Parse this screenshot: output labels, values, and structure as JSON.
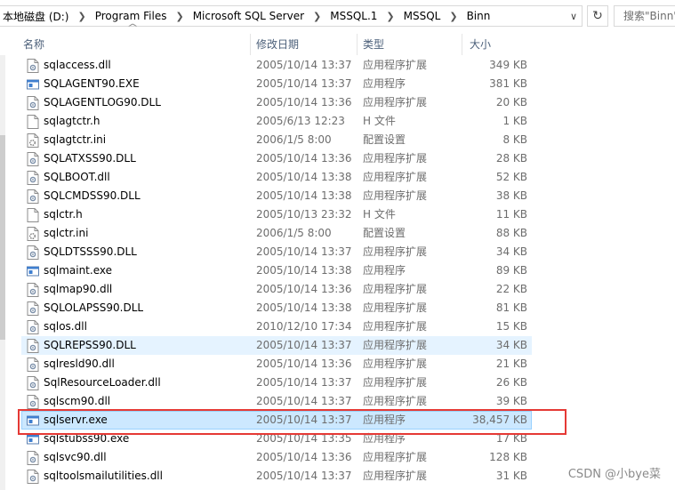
{
  "address": {
    "crumbs": [
      "本地磁盘 (D:)",
      "Program Files",
      "Microsoft SQL Server",
      "MSSQL.1",
      "MSSQL",
      "Binn"
    ]
  },
  "search": {
    "placeholder": "搜索\"Binn\""
  },
  "columns": {
    "name": "名称",
    "date": "修改日期",
    "type": "类型",
    "size": "大小"
  },
  "files": [
    {
      "name": "sqlaccess.dll",
      "date": "2005/10/14 13:37",
      "type": "应用程序扩展",
      "size": "349 KB",
      "icon": "dll-icon"
    },
    {
      "name": "SQLAGENT90.EXE",
      "date": "2005/10/14 13:37",
      "type": "应用程序",
      "size": "381 KB",
      "icon": "exe-icon"
    },
    {
      "name": "SQLAGENTLOG90.DLL",
      "date": "2005/10/14 13:36",
      "type": "应用程序扩展",
      "size": "20 KB",
      "icon": "dll-icon"
    },
    {
      "name": "sqlagtctr.h",
      "date": "2005/6/13 12:23",
      "type": "H 文件",
      "size": "1 KB",
      "icon": "file-icon"
    },
    {
      "name": "sqlagtctr.ini",
      "date": "2006/1/5 8:00",
      "type": "配置设置",
      "size": "8 KB",
      "icon": "ini-icon"
    },
    {
      "name": "SQLATXSS90.DLL",
      "date": "2005/10/14 13:36",
      "type": "应用程序扩展",
      "size": "28 KB",
      "icon": "dll-icon"
    },
    {
      "name": "SQLBOOT.dll",
      "date": "2005/10/14 13:38",
      "type": "应用程序扩展",
      "size": "52 KB",
      "icon": "dll-icon"
    },
    {
      "name": "SQLCMDSS90.DLL",
      "date": "2005/10/14 13:38",
      "type": "应用程序扩展",
      "size": "38 KB",
      "icon": "dll-icon"
    },
    {
      "name": "sqlctr.h",
      "date": "2005/10/13 23:32",
      "type": "H 文件",
      "size": "11 KB",
      "icon": "file-icon"
    },
    {
      "name": "sqlctr.ini",
      "date": "2006/1/5 8:00",
      "type": "配置设置",
      "size": "88 KB",
      "icon": "ini-icon"
    },
    {
      "name": "SQLDTSSS90.DLL",
      "date": "2005/10/14 13:37",
      "type": "应用程序扩展",
      "size": "34 KB",
      "icon": "dll-icon"
    },
    {
      "name": "sqlmaint.exe",
      "date": "2005/10/14 13:38",
      "type": "应用程序",
      "size": "89 KB",
      "icon": "exe-icon"
    },
    {
      "name": "sqlmap90.dll",
      "date": "2005/10/14 13:36",
      "type": "应用程序扩展",
      "size": "22 KB",
      "icon": "dll-icon"
    },
    {
      "name": "SQLOLAPSS90.DLL",
      "date": "2005/10/14 13:38",
      "type": "应用程序扩展",
      "size": "81 KB",
      "icon": "dll-icon"
    },
    {
      "name": "sqlos.dll",
      "date": "2010/12/10 17:34",
      "type": "应用程序扩展",
      "size": "15 KB",
      "icon": "dll-icon"
    },
    {
      "name": "SQLREPSS90.DLL",
      "date": "2005/10/14 13:37",
      "type": "应用程序扩展",
      "size": "34 KB",
      "icon": "dll-icon",
      "state": "hover"
    },
    {
      "name": "sqlresld90.dll",
      "date": "2005/10/14 13:36",
      "type": "应用程序扩展",
      "size": "21 KB",
      "icon": "dll-icon"
    },
    {
      "name": "SqlResourceLoader.dll",
      "date": "2005/10/14 13:37",
      "type": "应用程序扩展",
      "size": "26 KB",
      "icon": "dll-icon"
    },
    {
      "name": "sqlscm90.dll",
      "date": "2005/10/14 13:37",
      "type": "应用程序扩展",
      "size": "39 KB",
      "icon": "dll-icon"
    },
    {
      "name": "sqlservr.exe",
      "date": "2005/10/14 13:37",
      "type": "应用程序",
      "size": "38,457 KB",
      "icon": "exe-icon",
      "state": "selected"
    },
    {
      "name": "sqlstubss90.exe",
      "date": "2005/10/14 13:35",
      "type": "应用程序",
      "size": "17 KB",
      "icon": "exe-icon"
    },
    {
      "name": "sqlsvc90.dll",
      "date": "2005/10/14 13:36",
      "type": "应用程序扩展",
      "size": "128 KB",
      "icon": "dll-icon"
    },
    {
      "name": "sqltoolsmailutilities.dll",
      "date": "2005/10/14 13:37",
      "type": "应用程序扩展",
      "size": "31 KB",
      "icon": "dll-icon"
    }
  ],
  "watermark": "CSDN @小bye菜",
  "colors": {
    "selected_bg": "#cce8ff",
    "hover_bg": "#e5f3ff",
    "highlight_box": "#e53935"
  }
}
